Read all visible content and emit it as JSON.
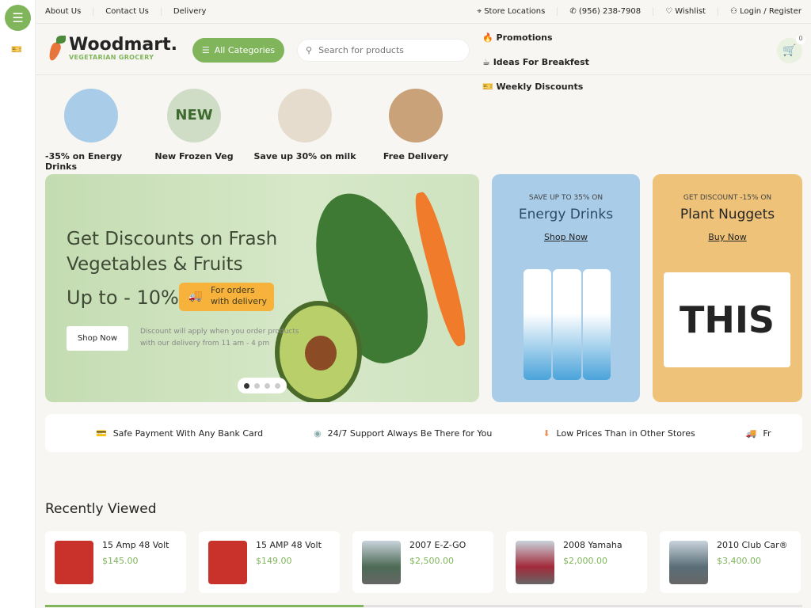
{
  "sidebar": {
    "menu_icon": "hamburger-icon",
    "discount_icon": "discount-ticket-icon"
  },
  "topbar": {
    "links": [
      "About Us",
      "Contact Us",
      "Delivery"
    ],
    "store": "Store Locations",
    "phone": "(956) 238-7908",
    "wishlist": "Wishlist",
    "login": "Login / Register"
  },
  "header": {
    "logo_name": "Woodmart.",
    "logo_sub": "VEGETARIAN GROCERY",
    "all_categories": "All Categories",
    "search_placeholder": "Search for products",
    "nav": [
      "Promotions",
      "Ideas For Breakfest",
      "Weekly Discounts"
    ],
    "cart_count": "0"
  },
  "categories": [
    "-35% on Energy Drinks",
    "New Frozen Veg",
    "Save up 30% on milk",
    "Free Delivery"
  ],
  "hero": {
    "title1": "Get Discounts on Frash",
    "title2": "Vegetables & Fruits",
    "upto": "Up to - 10%",
    "tag1": "For orders",
    "tag2": "with delivery",
    "button": "Shop Now",
    "note1": "Discount will apply when you order products",
    "note2": "with our delivery from 11 am - 4 pm",
    "slide_count": 4,
    "active_slide": 1
  },
  "energy": {
    "sub": "SAVE UP TO 35% ON",
    "title": "Energy Drinks",
    "link": "Shop Now"
  },
  "nuggets": {
    "sub": "GET DISCOUNT -15% ON",
    "title": "Plant Nuggets",
    "link": "Buy Now",
    "box_text": "THIS"
  },
  "features": [
    "Safe Payment With Any Bank Card",
    "24/7 Support Always Be There for You",
    "Low Prices Than in Other Stores",
    "Fr"
  ],
  "recent": {
    "title": "Recently Viewed",
    "items": [
      {
        "name": "15 Amp 48 Volt",
        "price": "$145.00"
      },
      {
        "name": "15 AMP 48 Volt",
        "price": "$149.00"
      },
      {
        "name": "2007 E-Z-GO",
        "price": "$2,500.00"
      },
      {
        "name": "2008 Yamaha",
        "price": "$2,000.00"
      },
      {
        "name": "2010 Club Car®",
        "price": "$3,400.00"
      }
    ],
    "scroll_progress": 0.42
  },
  "colors": {
    "accent": "#80b55c",
    "tag": "#f7b23b"
  }
}
